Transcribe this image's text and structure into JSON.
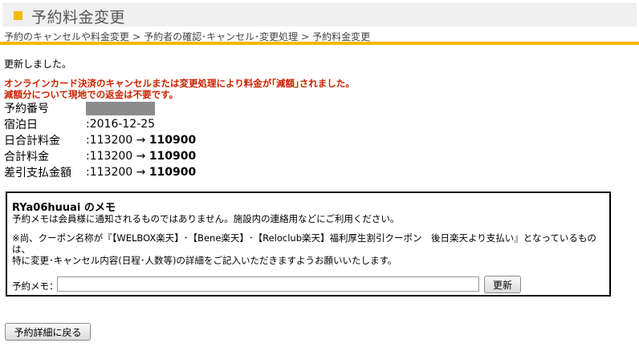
{
  "page": {
    "title": "予約料金変更"
  },
  "breadcrumb": {
    "items": [
      "予約のキャンセルや料金変更",
      "予約者の確認･キャンセル･変更処理",
      "予約料金変更"
    ],
    "separator": ">"
  },
  "message": {
    "updated": "更新しました。",
    "notice_line1": "オンラインカード決済のキャンセルまたは変更処理により料金が｢減額｣されました。",
    "notice_line2": "減額分について現地での返金は不要です。"
  },
  "reservation": {
    "number_label": "予約番号",
    "stay_date_label": "宿泊日",
    "stay_date_value": ":2016-12-25",
    "daily_total_label": "日合計料金",
    "daily_total_old": ":113200",
    "daily_total_new": "110900",
    "total_label": "合計料金",
    "total_old": ":113200",
    "total_new": "110900",
    "diff_label": "差引支払金額",
    "diff_old": ":113200",
    "diff_new": "110900",
    "arrow": "→"
  },
  "memo": {
    "title": "RYa06huuai のメモ",
    "description": "予約メモは会員様に通知されるものではありません。施設内の連絡用などにご利用ください。",
    "note_line1": "※尚、クーポン名称が『【WELBOX楽天】･【Bene楽天】･【Reloclub楽天】福利厚生割引クーポン　後日楽天より支払い』となっているものは、",
    "note_line2": "特に変更･キャンセル内容(日程･人数等)の詳細をご記入いただきますようお願いいたします。",
    "input_label": "予約メモ：",
    "input_value": "",
    "update_button": "更新"
  },
  "footer": {
    "back_button": "予約詳細に戻る"
  },
  "colors": {
    "accent": "#f5b800",
    "notice": "#cc2200"
  }
}
